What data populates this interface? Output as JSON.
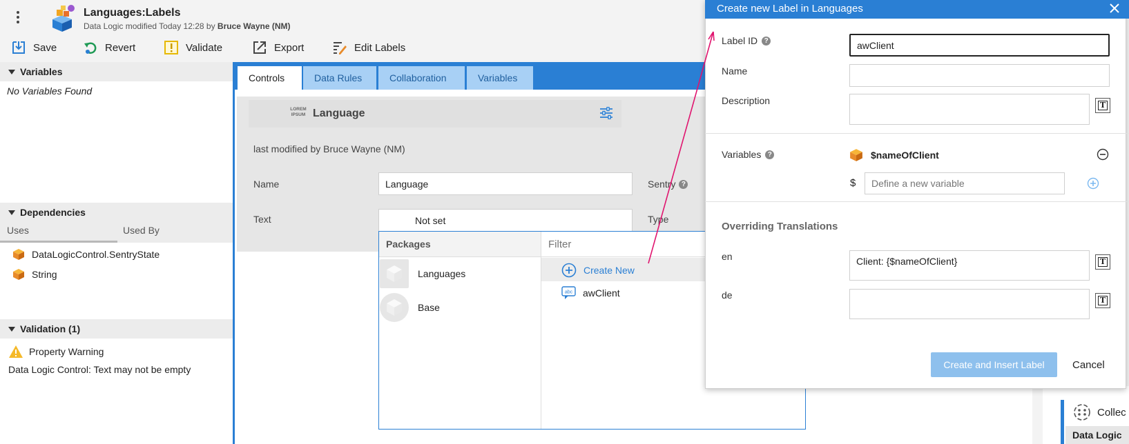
{
  "header": {
    "title": "Languages:Labels",
    "subtitle_prefix": "Data Logic modified Today 12:28 by",
    "subtitle_user": "Bruce Wayne (NM)"
  },
  "toolbar": {
    "save": "Save",
    "revert": "Revert",
    "validate": "Validate",
    "export": "Export",
    "edit_labels": "Edit Labels"
  },
  "left_panel": {
    "variables_header": "Variables",
    "no_variables": "No Variables Found",
    "dependencies_header": "Dependencies",
    "tab_uses": "Uses",
    "tab_used_by": "Used By",
    "dependencies": [
      "DataLogicControl.SentryState",
      "String"
    ],
    "validation_header": "Validation (1)",
    "warning_title": "Property Warning",
    "warning_text": "Data Logic Control: Text may not be empty"
  },
  "tabs": [
    "Controls",
    "Data Rules",
    "Collaboration",
    "Variables"
  ],
  "control_card": {
    "icon_text_1": "LOREM",
    "icon_text_2": "IPSUM",
    "title": "Language",
    "last_modified": "last modified by Bruce Wayne (NM)",
    "name_label": "Name",
    "name_value": "Language",
    "sentry_label": "Sentry",
    "text_label": "Text",
    "text_value": "Not set",
    "type_label": "Type"
  },
  "popup": {
    "packages_header": "Packages",
    "packages": [
      "Languages",
      "Base"
    ],
    "filter_placeholder": "Filter",
    "create_new": "Create New",
    "labels": [
      "awClient"
    ]
  },
  "right_bg": {
    "collect_label": "Collec",
    "data_logic_label": "Data Logic"
  },
  "modal": {
    "title": "Create new Label in Languages",
    "label_id_label": "Label ID",
    "label_id_value": "awClient",
    "name_label": "Name",
    "name_value": "",
    "description_label": "Description",
    "description_value": "",
    "variables_label": "Variables",
    "variable_name": "$nameOfClient",
    "dollar": "$",
    "new_variable_placeholder": "Define a new variable",
    "overriding_header": "Overriding Translations",
    "translations": [
      {
        "lang": "en",
        "value": "Client: {$nameOfClient}"
      },
      {
        "lang": "de",
        "value": ""
      }
    ],
    "create_button": "Create and Insert Label",
    "cancel_button": "Cancel"
  },
  "colors": {
    "accent": "#2a7fd4",
    "tab_inactive": "#a8d0f5",
    "arrow": "#e0146e",
    "create_button": "#8ec0ed"
  }
}
